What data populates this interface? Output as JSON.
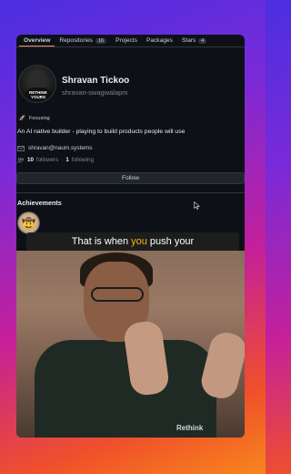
{
  "tabs": [
    {
      "label": "Overview",
      "count": null,
      "active": true
    },
    {
      "label": "Repositories",
      "count": "16",
      "active": false
    },
    {
      "label": "Projects",
      "count": null,
      "active": false
    },
    {
      "label": "Packages",
      "count": null,
      "active": false
    },
    {
      "label": "Stars",
      "count": "4",
      "active": false
    }
  ],
  "profile": {
    "name": "Shravan Tickoo",
    "handle": "shravan-swagwalapm",
    "avatar_text": "RETHINK YOURS",
    "status_emoji": "🚀",
    "status": "Focusing",
    "bio": "An AI native builder - playing to build products people will use",
    "email": "shravan@naum.systems",
    "followers_count": "10",
    "followers_label": "followers",
    "separator": "·",
    "following_count": "1",
    "following_label": "following"
  },
  "follow_button": "Follow",
  "achievements": {
    "title": "Achievements",
    "badge_emoji": "🤠"
  },
  "caption": {
    "before": "That is when",
    "highlight": "you",
    "after": "push your"
  },
  "video": {
    "shirt_text": "Rethink"
  },
  "colors": {
    "panel": "#0d1117",
    "border": "#30363d",
    "highlight": "#f5b800",
    "active_tab": "#f78166"
  }
}
